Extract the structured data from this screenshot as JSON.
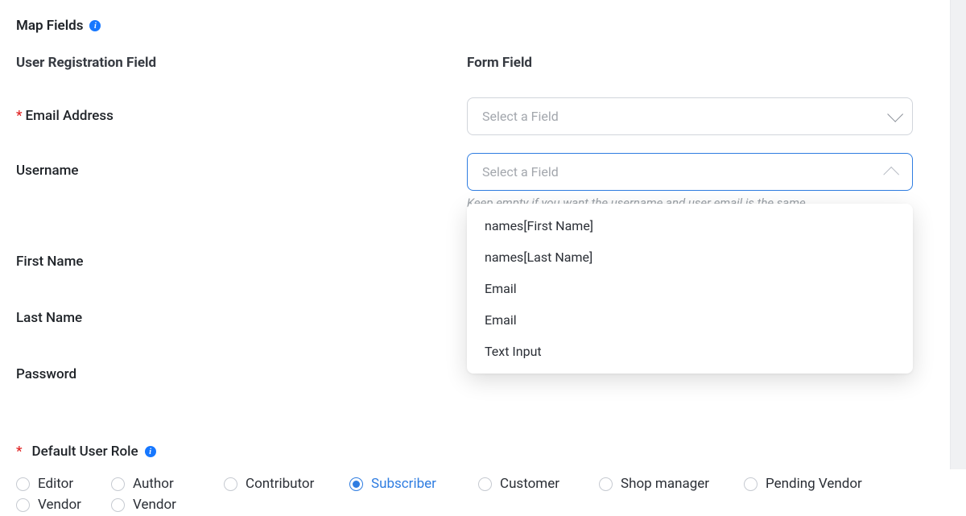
{
  "section_title": "Map Fields",
  "columns": {
    "left": "User Registration Field",
    "right": "Form Field"
  },
  "select_placeholder": "Select a Field",
  "fields": {
    "email": {
      "label": "Email Address",
      "required": true
    },
    "username": {
      "label": "Username",
      "hint": "Keep empty if you want the username and user email is the same"
    },
    "first_name": {
      "label": "First Name"
    },
    "last_name": {
      "label": "Last Name"
    },
    "password": {
      "label": "Password"
    }
  },
  "dropdown_options": [
    "names[First Name]",
    "names[Last Name]",
    "Email",
    "Email",
    "Text Input"
  ],
  "role": {
    "title": "Default User Role",
    "required": true,
    "selected": "Subscriber",
    "options_row1": [
      "Editor",
      "Author",
      "Contributor",
      "Subscriber",
      "Customer",
      "Shop manager",
      "Pending Vendor"
    ],
    "options_row2": [
      "Vendor",
      "Vendor"
    ]
  }
}
